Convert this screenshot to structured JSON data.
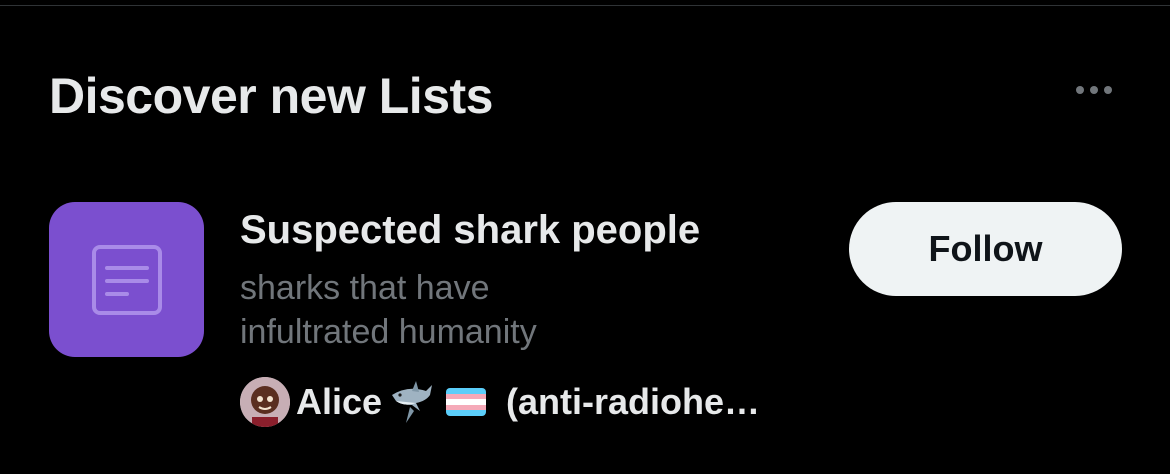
{
  "section": {
    "title": "Discover new Lists",
    "more_icon": "more-horizontal-icon"
  },
  "list": {
    "icon": "list-document-icon",
    "icon_bg": "#7b4fcf",
    "name": "Suspected shark people",
    "description_lines": [
      "sharks that have",
      "infultrated humanity"
    ],
    "owner": {
      "name": "Alice",
      "emoji": [
        "shark-icon",
        "transgender-flag-icon"
      ],
      "suffix": "(anti-radiohe…"
    },
    "follow_label": "Follow"
  },
  "colors": {
    "background": "#000000",
    "primary_text": "#e7e9ea",
    "secondary_text": "#71767b",
    "button_bg": "#eff3f4",
    "button_text": "#0f1419"
  }
}
